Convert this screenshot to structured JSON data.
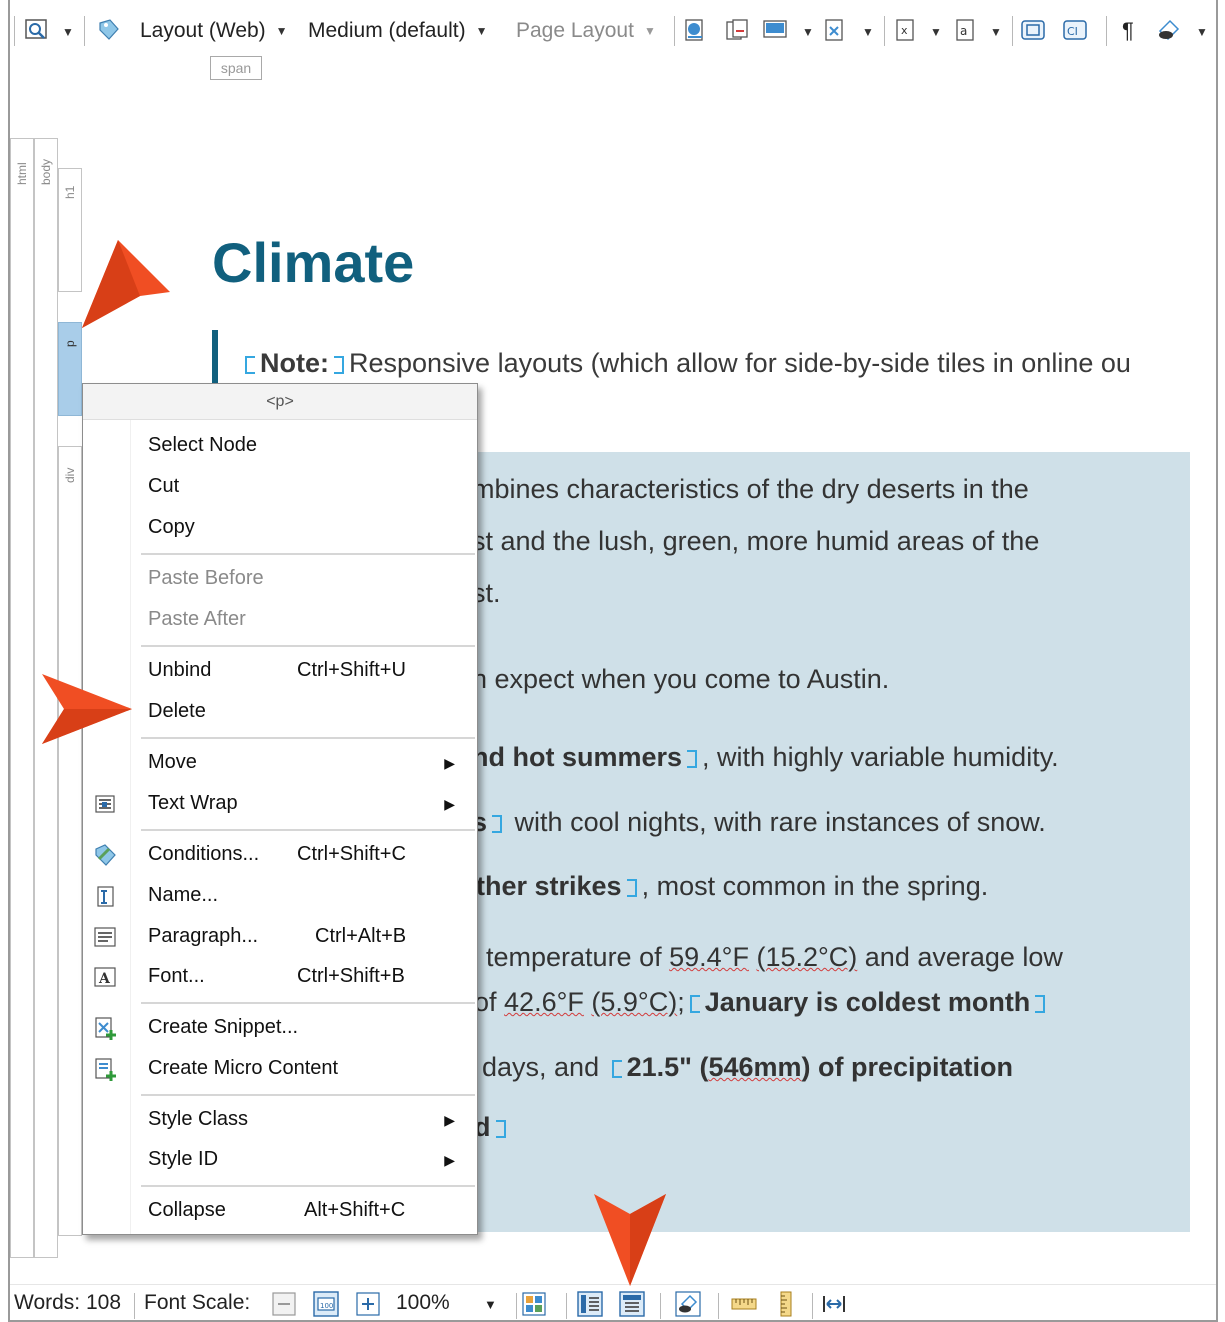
{
  "toolbar": {
    "layout_label": "Layout (Web)",
    "medium_label": "Medium (default)",
    "page_layout_label": "Page Layout",
    "pilcrow": "¶"
  },
  "structure": {
    "span_tag": "span",
    "html_label": "html",
    "body_label": "body",
    "h1_label": "h1",
    "p_label": "p",
    "div_label": "div"
  },
  "document": {
    "heading": "Climate",
    "note_label": "Note:",
    "note_text": "Responsive layouts (which allow for side-by-side tiles in online ou",
    "line1": "mbines characteristics of the dry deserts in the",
    "line2": "st and the lush, green, more humid areas of the",
    "line3": "st.",
    "line4": "n expect when you come to Austin.",
    "line5_bold": "nd hot summers",
    "line5_rest": ", with highly variable humidity.",
    "line6_bold": "s",
    "line6_rest": "with cool nights, with rare instances of snow.",
    "line7_bold": "ther strikes",
    "line7_rest": ", most common in the spring.",
    "line8_pre": "temperature of ",
    "line8_t1": "59.4°F",
    "line8_t2": "(15.2°C)",
    "line8_post": " and average low",
    "line9_pre": "of ",
    "line9_t1": "42.6°F",
    "line9_t2": "(5.9°C)",
    "line9_sep": ";",
    "line9_bold": "January is coldest month",
    "line10_pre": "days, and",
    "line10_bold_a": "21.5\" (",
    "line10_bold_sq": "546mm",
    "line10_bold_b": ") of precipitation",
    "line11_bold": "d"
  },
  "context_menu": {
    "header": "<p>",
    "items": {
      "select_node": "Select Node",
      "cut": "Cut",
      "copy": "Copy",
      "paste_before": "Paste Before",
      "paste_after": "Paste After",
      "unbind": "Unbind",
      "unbind_sc": "Ctrl+Shift+U",
      "delete": "Delete",
      "move": "Move",
      "text_wrap": "Text Wrap",
      "conditions": "Conditions...",
      "conditions_sc": "Ctrl+Shift+C",
      "name": "Name...",
      "paragraph": "Paragraph...",
      "paragraph_sc": "Ctrl+Alt+B",
      "font": "Font...",
      "font_sc": "Ctrl+Shift+B",
      "create_snippet": "Create Snippet...",
      "create_micro": "Create Micro Content",
      "style_class": "Style Class",
      "style_id": "Style ID",
      "collapse": "Collapse",
      "collapse_sc": "Alt+Shift+C"
    }
  },
  "statusbar": {
    "words": "Words: 108",
    "font_scale": "Font Scale:",
    "zoom": "100%"
  },
  "colors": {
    "heading": "#11607e",
    "div_background": "#cfe0e8",
    "tag_marker": "#35a7e0",
    "callout": "#f04e23"
  }
}
